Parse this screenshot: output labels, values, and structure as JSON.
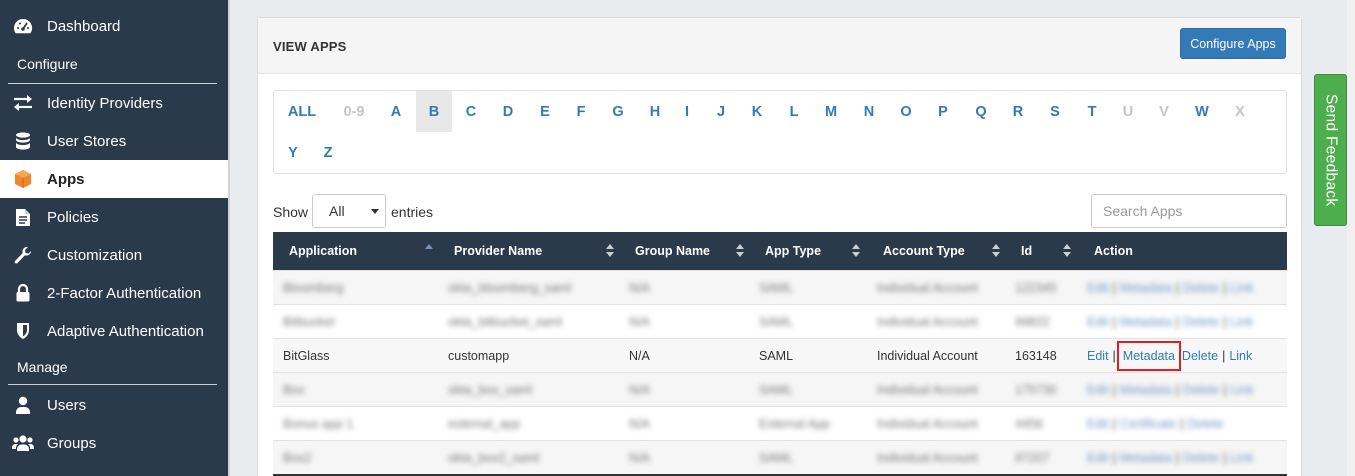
{
  "sidebar": {
    "items": [
      {
        "label": "Dashboard",
        "icon": "dashboard-icon"
      },
      {
        "label": "Identity Providers",
        "icon": "exchange-icon"
      },
      {
        "label": "User Stores",
        "icon": "database-icon"
      },
      {
        "label": "Apps",
        "icon": "cube-icon",
        "active": true
      },
      {
        "label": "Policies",
        "icon": "document-icon"
      },
      {
        "label": "Customization",
        "icon": "wrench-icon"
      },
      {
        "label": "2-Factor Authentication",
        "icon": "lock-icon"
      },
      {
        "label": "Adaptive Authentication",
        "icon": "shield-icon"
      },
      {
        "label": "Users",
        "icon": "user-icon"
      },
      {
        "label": "Groups",
        "icon": "users-icon"
      }
    ],
    "sections": {
      "configure": "Configure",
      "manage": "Manage"
    }
  },
  "panel": {
    "title": "VIEW APPS",
    "configure_button": "Configure Apps"
  },
  "alphabet": {
    "letters": [
      "ALL",
      "0-9",
      "A",
      "B",
      "C",
      "D",
      "E",
      "F",
      "G",
      "H",
      "I",
      "J",
      "K",
      "L",
      "M",
      "N",
      "O",
      "P",
      "Q",
      "R",
      "S",
      "T",
      "U",
      "V",
      "W",
      "X",
      "Y",
      "Z"
    ],
    "disabled": [
      "0-9",
      "U",
      "V",
      "X"
    ],
    "active": "B"
  },
  "table_controls": {
    "show_label": "Show",
    "entries_value": "All",
    "entries_label": "entries",
    "search_placeholder": "Search Apps"
  },
  "table": {
    "columns": [
      "Application",
      "Provider Name",
      "Group Name",
      "App Type",
      "Account Type",
      "Id",
      "Action"
    ],
    "rows": [
      {
        "application": "Bloomberg",
        "provider": "okta_bloomberg_saml",
        "group": "N/A",
        "app_type": "SAML",
        "account_type": "Individual Account",
        "id": "122345",
        "actions": [
          "Edit",
          "Metadata",
          "Delete",
          "Link"
        ],
        "blurred": true
      },
      {
        "application": "Bitbucket",
        "provider": "okta_bitbucket_saml",
        "group": "N/A",
        "app_type": "SAML",
        "account_type": "Individual Account",
        "id": "99822",
        "actions": [
          "Edit",
          "Metadata",
          "Delete",
          "Link"
        ],
        "blurred": true
      },
      {
        "application": "BitGlass",
        "provider": "customapp",
        "group": "N/A",
        "app_type": "SAML",
        "account_type": "Individual Account",
        "id": "163148",
        "actions": [
          "Edit",
          "Metadata",
          "Delete",
          "Link"
        ],
        "blurred": false,
        "highlight": "Metadata"
      },
      {
        "application": "Box",
        "provider": "okta_box_saml",
        "group": "N/A",
        "app_type": "SAML",
        "account_type": "Individual Account",
        "id": "175730",
        "actions": [
          "Edit",
          "Metadata",
          "Delete",
          "Link"
        ],
        "blurred": true
      },
      {
        "application": "Bonus app 1",
        "provider": "external_app",
        "group": "N/A",
        "app_type": "External App",
        "account_type": "Individual Account",
        "id": "4456",
        "actions": [
          "Edit",
          "Certificate",
          "Delete"
        ],
        "blurred": true
      },
      {
        "application": "Box2",
        "provider": "okta_box2_saml",
        "group": "N/A",
        "app_type": "SAML",
        "account_type": "Individual Account",
        "id": "97207",
        "actions": [
          "Edit",
          "Metadata",
          "Delete",
          "Link"
        ],
        "blurred": true
      }
    ]
  },
  "feedback": {
    "label": "Send Feedback"
  },
  "colors": {
    "sidebar_bg": "#2b3a4a",
    "primary": "#337ab7",
    "feedback": "#4cae4c",
    "highlight": "#e02020"
  }
}
